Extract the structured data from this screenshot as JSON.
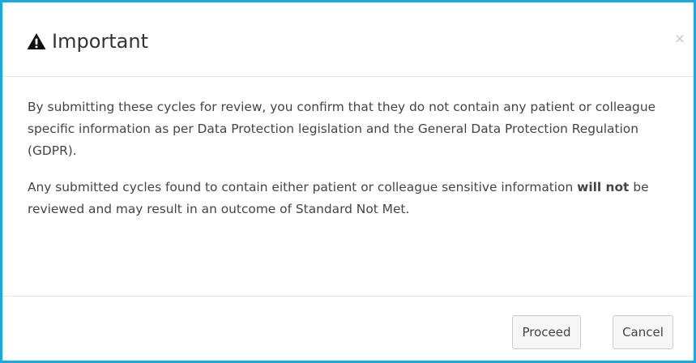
{
  "dialog": {
    "title": "Important",
    "icon": "warning-icon",
    "close_label": "×"
  },
  "body": {
    "paragraph1": "By submitting these cycles for review, you confirm that they do not contain any patient or colleague specific information as per Data Protection legislation and the General Data Protection Regulation (GDPR).",
    "paragraph2_before": "Any submitted cycles found to contain either patient or colleague sensitive information ",
    "paragraph2_bold": "will not",
    "paragraph2_after": " be reviewed and may result in an outcome of Standard Not Met."
  },
  "footer": {
    "proceed_label": "Proceed",
    "cancel_label": "Cancel"
  },
  "colors": {
    "border_accent": "#1ba9e1",
    "text": "#333333",
    "divider": "#e5e5e5"
  }
}
